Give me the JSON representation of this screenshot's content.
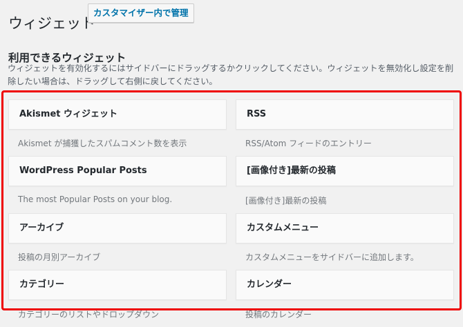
{
  "header": {
    "title": "ウィジェット",
    "action_button": "カスタマイザー内で管理"
  },
  "section": {
    "title": "利用できるウィジェット",
    "description": "ウィジェットを有効化するにはサイドバーにドラッグするかクリックしてください。ウィジェットを無効化し設定を削除したい場合は、ドラッグして右側に戻してください。"
  },
  "widgets": [
    {
      "title": "Akismet ウィジェット",
      "description": "Akismet が捕獲したスパムコメント数を表示"
    },
    {
      "title": "RSS",
      "description": "RSS/Atom フィードのエントリー"
    },
    {
      "title": "WordPress Popular Posts",
      "description": "The most Popular Posts on your blog."
    },
    {
      "title": "[画像付き]最新の投稿",
      "description": "[画像付き]最新の投稿"
    },
    {
      "title": "アーカイブ",
      "description": "投稿の月別アーカイブ"
    },
    {
      "title": "カスタムメニュー",
      "description": "カスタムメニューをサイドバーに追加します。"
    },
    {
      "title": "カテゴリー",
      "description": "カテゴリーのリストやドロップダウン"
    },
    {
      "title": "カレンダー",
      "description": "投稿のカレンダー"
    }
  ],
  "colors": {
    "highlight_border": "#ee0000",
    "link": "#0073aa",
    "background": "#f1f1f1"
  }
}
